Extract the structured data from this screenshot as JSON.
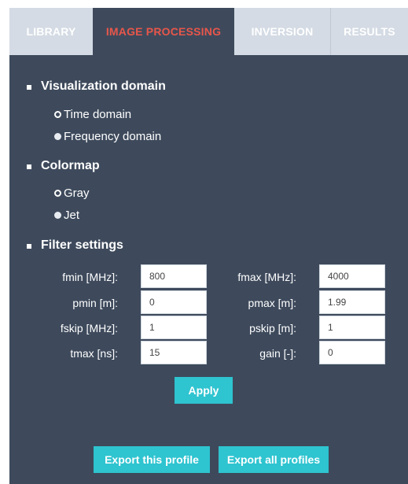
{
  "tabs": [
    {
      "label": "LIBRARY",
      "active": false
    },
    {
      "label": "IMAGE PROCESSING",
      "active": true
    },
    {
      "label": "INVERSION",
      "active": false
    },
    {
      "label": "RESULTS",
      "active": false
    }
  ],
  "visualization": {
    "title": "Visualization domain",
    "options": [
      {
        "label": "Time domain",
        "checked": true
      },
      {
        "label": "Frequency domain",
        "checked": false
      }
    ]
  },
  "colormap": {
    "title": "Colormap",
    "options": [
      {
        "label": "Gray",
        "checked": true
      },
      {
        "label": "Jet",
        "checked": false
      }
    ]
  },
  "filter": {
    "title": "Filter settings",
    "fields": [
      {
        "label": "fmin [MHz]:",
        "value": "800"
      },
      {
        "label": "fmax [MHz]:",
        "value": "4000"
      },
      {
        "label": "pmin [m]:",
        "value": "0"
      },
      {
        "label": "pmax [m]:",
        "value": "1.99"
      },
      {
        "label": "fskip [MHz]:",
        "value": "1"
      },
      {
        "label": "pskip [m]:",
        "value": "1"
      },
      {
        "label": "tmax [ns]:",
        "value": "15"
      },
      {
        "label": "gain [-]:",
        "value": "0"
      }
    ]
  },
  "buttons": {
    "apply": "Apply",
    "export_profile": "Export this profile",
    "export_all": "Export all profiles"
  },
  "colors": {
    "panel": "#3e4a5c",
    "tab_inactive": "#d4dbe4",
    "active_tab_text": "#e8564a",
    "button": "#2ec4d0"
  }
}
